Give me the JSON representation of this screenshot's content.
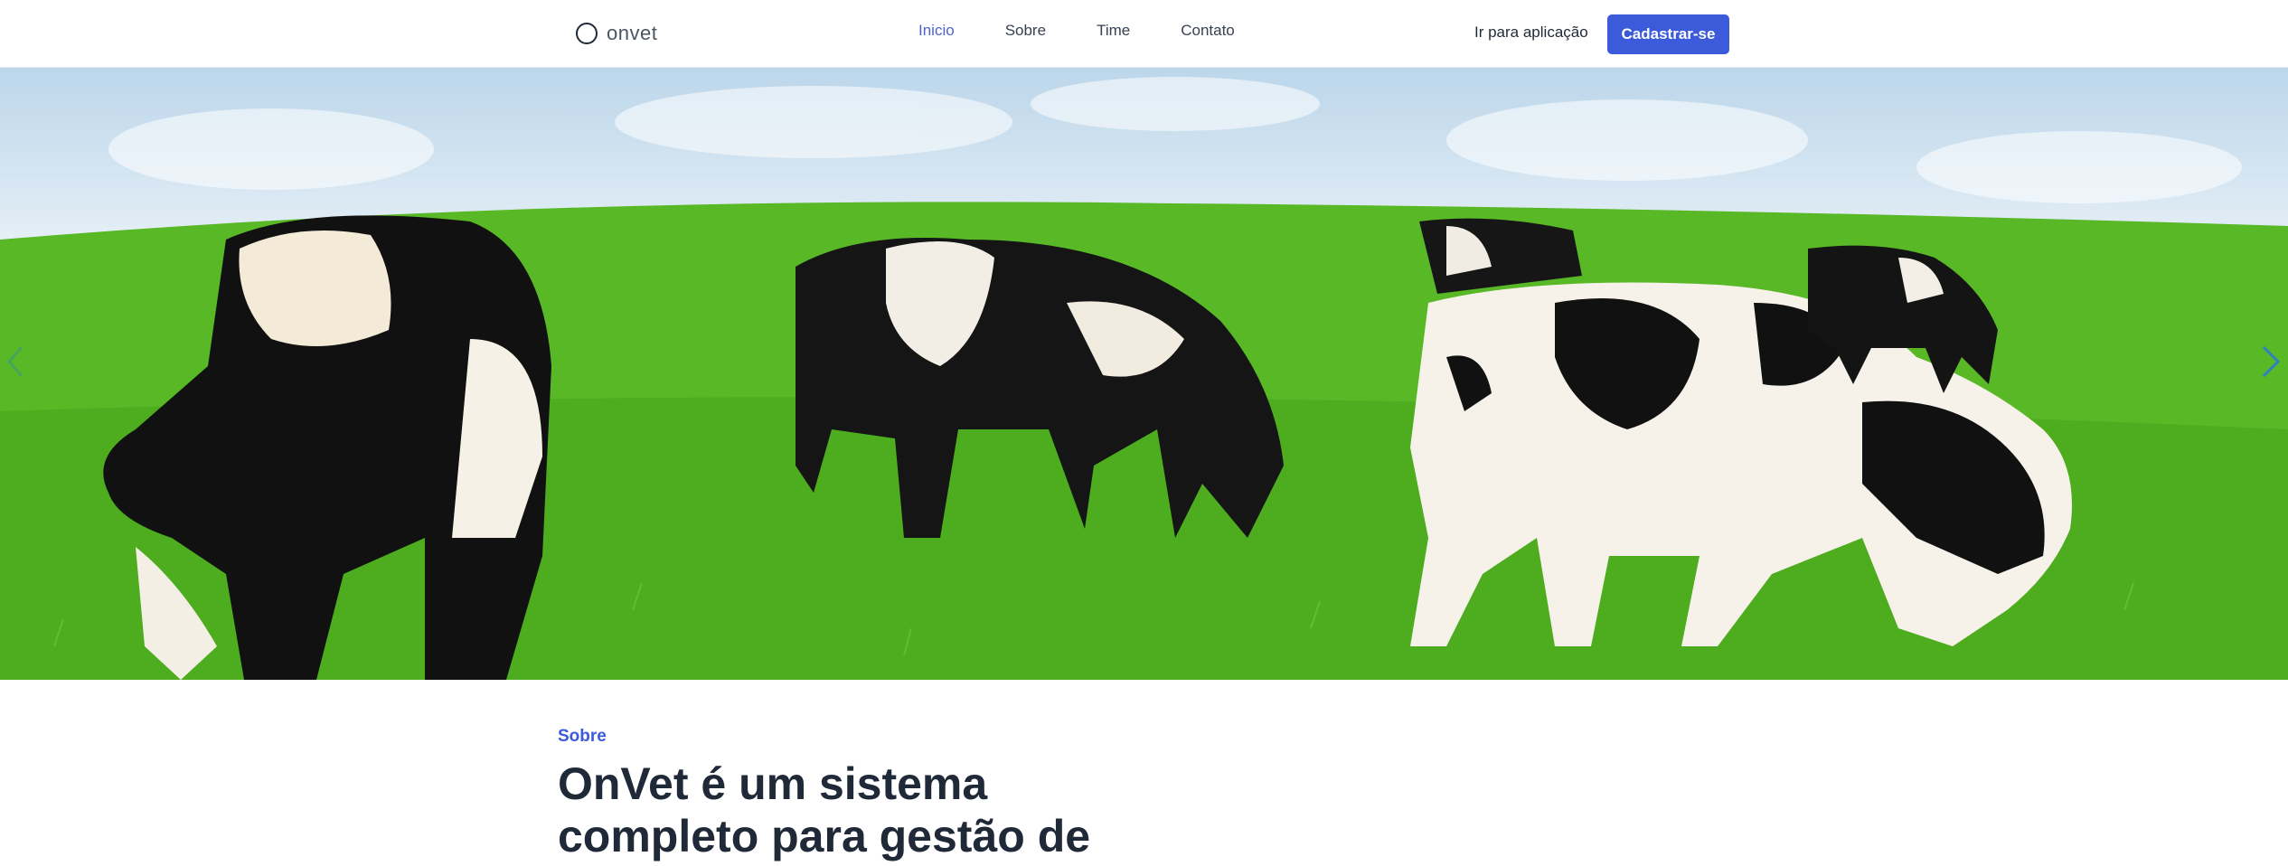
{
  "header": {
    "logo_text": "onvet",
    "nav": [
      {
        "label": "Inicio",
        "active": true
      },
      {
        "label": "Sobre",
        "active": false
      },
      {
        "label": "Time",
        "active": false
      },
      {
        "label": "Contato",
        "active": false
      }
    ],
    "go_to_app_label": "Ir para aplicação",
    "signup_label": "Cadastrar-se"
  },
  "hero": {
    "image": "cows-grazing-on-green-pasture",
    "prev_icon": "chevron-left-icon",
    "next_icon": "chevron-right-icon"
  },
  "about": {
    "eyebrow": "Sobre",
    "headline": "OnVet é um sistema completo para gestão de"
  },
  "colors": {
    "accent": "#3b5bdb",
    "nav_active": "#4f63d6",
    "text": "#1f2937"
  }
}
